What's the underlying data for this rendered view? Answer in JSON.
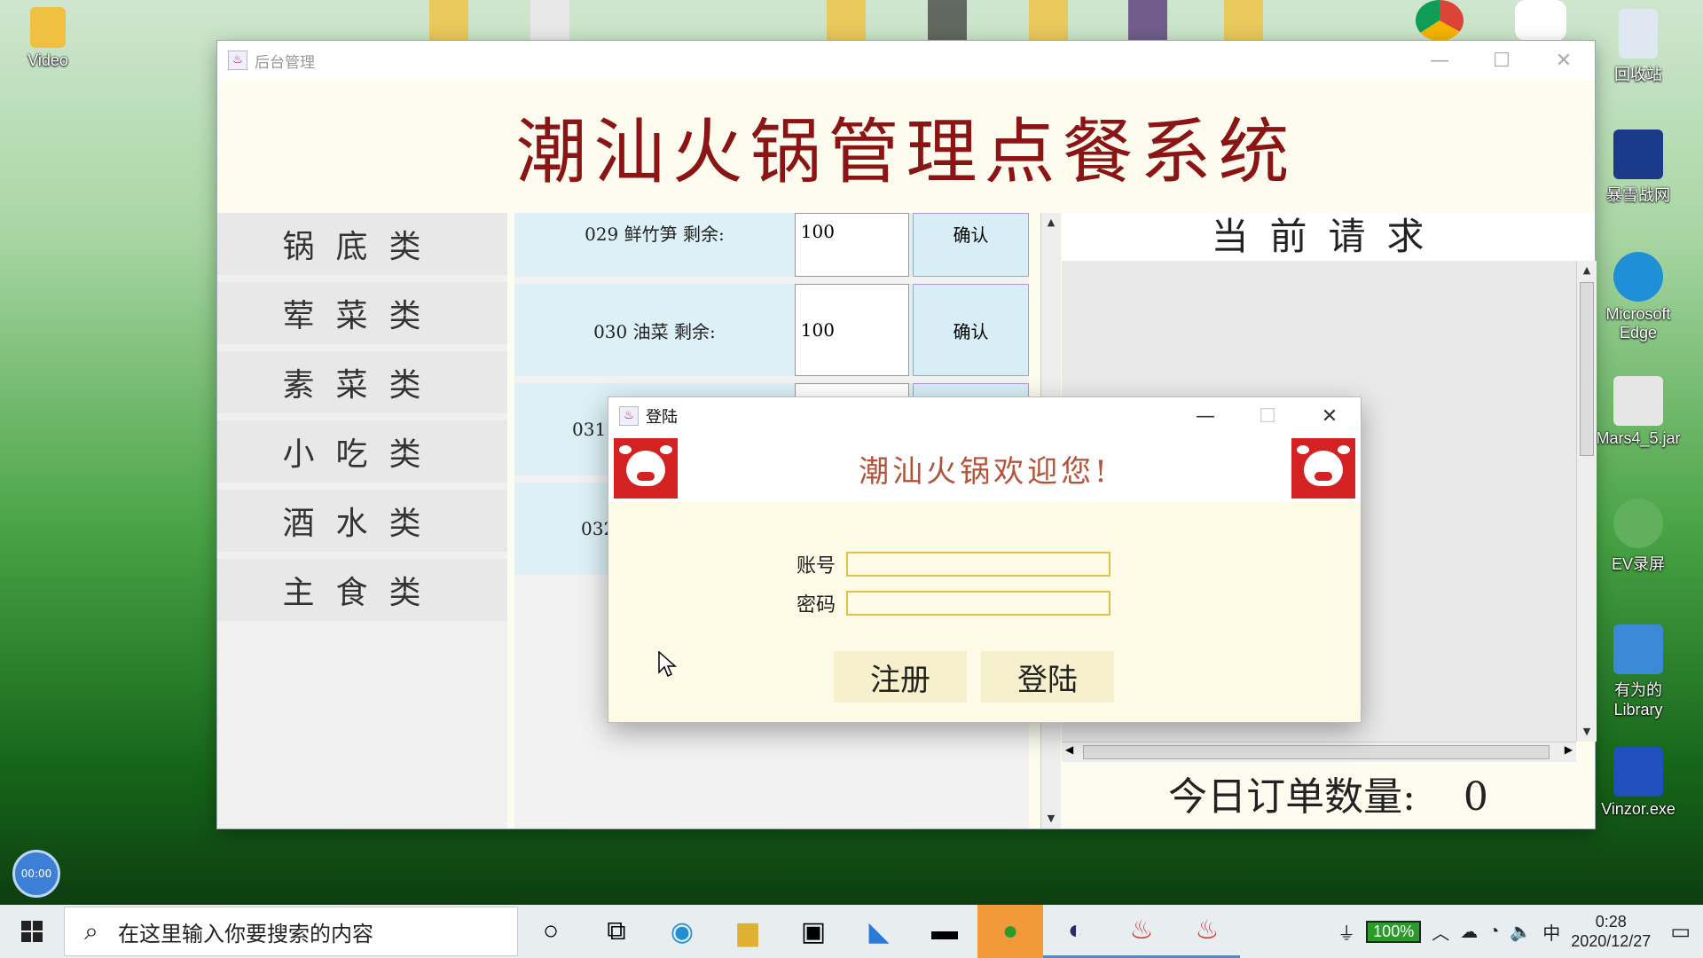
{
  "desktop": {
    "left_icons": [
      {
        "label": "Video",
        "color": "#f0c040"
      }
    ],
    "right_icons": [
      {
        "label": "回收站",
        "color": "#dfe8f0"
      },
      {
        "label": "暴雪战网",
        "color": "#1b3a8a"
      },
      {
        "label": "Microsoft Edge",
        "color": "#1f8fd8"
      },
      {
        "label": "Mars4_5.jar",
        "color": "#e6e6e6"
      },
      {
        "label": "EV录屏",
        "color": "#60b060"
      },
      {
        "label": "有为的 Library",
        "color": "#3a8ad8"
      },
      {
        "label": "Vinzor.exe",
        "color": "#2050c0"
      }
    ]
  },
  "main_window": {
    "title": "后台管理",
    "banner": "潮汕火锅管理点餐系统",
    "categories": [
      "锅底类",
      "荤菜类",
      "素菜类",
      "小吃类",
      "酒水类",
      "主食类"
    ],
    "dishes": [
      {
        "label": "029 鲜竹笋  剩余:",
        "qty": "100",
        "confirm": "确认"
      },
      {
        "label": "030 油菜  剩余:",
        "qty": "100",
        "confirm": "确认"
      },
      {
        "label": "031",
        "qty": "",
        "confirm": ""
      },
      {
        "label": "032",
        "qty": "",
        "confirm": ""
      }
    ],
    "request_title": "当前请求",
    "orders_label": "今日订单数量:",
    "orders_count": "0"
  },
  "login_dialog": {
    "title": "登陆",
    "welcome": "潮汕火锅欢迎您!",
    "account_label": "账号",
    "password_label": "密码",
    "account_value": "",
    "password_value": "",
    "register_label": "注册",
    "login_label": "登陆"
  },
  "recorder": {
    "time": "00:00"
  },
  "taskbar": {
    "search_placeholder": "在这里输入你要搜索的内容",
    "battery": "100%",
    "ime": "中",
    "time": "0:28",
    "date": "2020/12/27"
  }
}
